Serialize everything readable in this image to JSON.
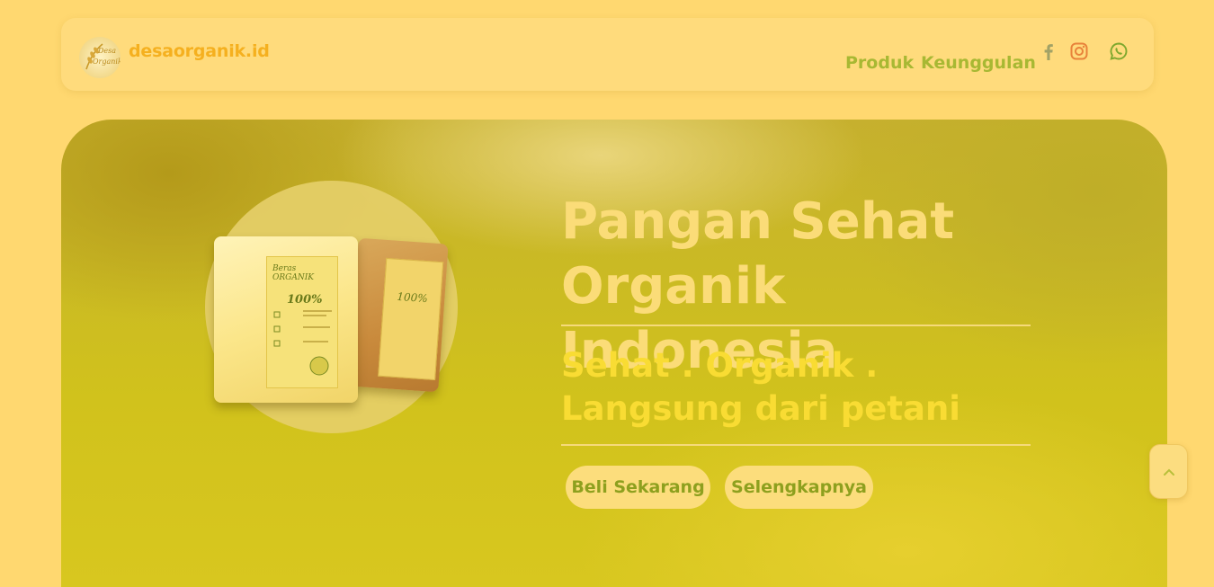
{
  "navbar": {
    "brand": "desaorganik.id",
    "logo_text_line1": "Desa",
    "logo_text_line2": "Organik",
    "links": [
      {
        "label": "Produk"
      },
      {
        "label": "Keunggulan"
      }
    ],
    "social_icons": [
      "facebook-icon",
      "instagram-icon",
      "whatsapp-icon"
    ]
  },
  "hero": {
    "title_line1": "Pangan Sehat",
    "title_line2": "Organik Indonesia",
    "subtitle_line1": "Sehat . Organik .",
    "subtitle_line2": "Langsung dari petani",
    "buy_button": "Beli Sekarang",
    "more_button": "Selengkapnya",
    "product_label": "Beras ORGANIK",
    "product_badge": "100%"
  },
  "scroll_top_icon": "chevron-up-icon",
  "colors": {
    "page_bg": "#ffd870",
    "brand": "#f5b01f",
    "nav_link": "#a8b833",
    "hero_title": "#fbdc78",
    "hero_subtitle": "#f9dc33",
    "button_bg": "#fcdd7c",
    "button_text": "#8ea01e"
  }
}
